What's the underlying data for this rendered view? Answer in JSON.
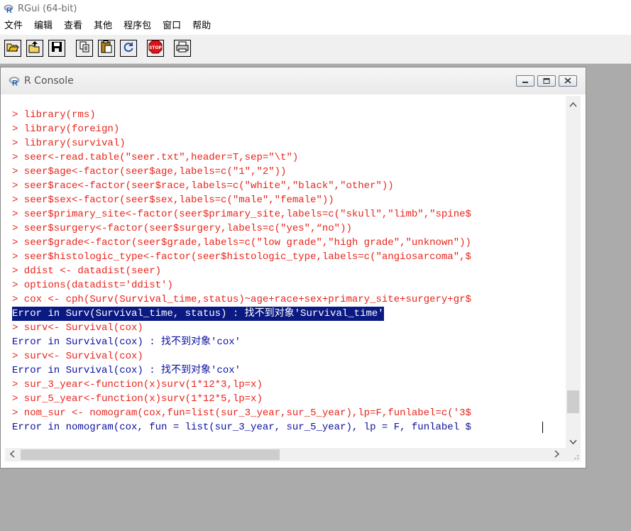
{
  "app": {
    "title": "RGui (64-bit)"
  },
  "menu": [
    "文件",
    "编辑",
    "查看",
    "其他",
    "程序包",
    "窗口",
    "帮助"
  ],
  "toolbar": {
    "buttons": [
      "open-script-icon",
      "load-workspace-icon",
      "save-workspace-icon",
      "copy-icon",
      "paste-icon",
      "copy-paste-icon",
      "stop-icon",
      "print-icon"
    ],
    "stop_label": "STOP"
  },
  "console": {
    "title": "R Console",
    "lines": [
      {
        "type": "cmd",
        "text": "> library(rms)"
      },
      {
        "type": "cmd",
        "text": "> library(foreign)"
      },
      {
        "type": "cmd",
        "text": "> library(survival)"
      },
      {
        "type": "cmd",
        "text": "> seer<-read.table(\"seer.txt\",header=T,sep=\"\\t\")"
      },
      {
        "type": "cmd",
        "text": "> seer$age<-factor(seer$age,labels=c(\"1\",\"2\"))"
      },
      {
        "type": "cmd",
        "text": "> seer$race<-factor(seer$race,labels=c(\"white\",\"black\",\"other\"))"
      },
      {
        "type": "cmd",
        "text": "> seer$sex<-factor(seer$sex,labels=c(\"male\",\"female\"))"
      },
      {
        "type": "cmd",
        "text": "> seer$primary_site<-factor(seer$primary_site,labels=c(\"skull\",\"limb\",\"spine$"
      },
      {
        "type": "cmd",
        "text": "> seer$surgery<-factor(seer$surgery,labels=c(\"yes\",“no\"))"
      },
      {
        "type": "cmd",
        "text": "> seer$grade<-factor(seer$grade,labels=c(\"low grade\",\"high grade\",\"unknown\"))"
      },
      {
        "type": "cmd",
        "text": "> seer$histologic_type<-factor(seer$histologic_type,labels=c(\"angiosarcoma\",$"
      },
      {
        "type": "cmd",
        "text": "> ddist <- datadist(seer)"
      },
      {
        "type": "cmd",
        "text": "> options(datadist='ddist')"
      },
      {
        "type": "cmd",
        "text": "> cox <- cph(Surv(Survival_time,status)~age+race+sex+primary_site+surgery+gr$"
      },
      {
        "type": "sel",
        "text": "Error in Surv(Survival_time, status) : 找不到对象'Survival_time'"
      },
      {
        "type": "cmd",
        "text": "> surv<- Survival(cox)"
      },
      {
        "type": "err",
        "text": "Error in Survival(cox) : 找不到对象'cox'"
      },
      {
        "type": "cmd",
        "text": "> surv<- Survival(cox)"
      },
      {
        "type": "err",
        "text": "Error in Survival(cox) : 找不到对象'cox'"
      },
      {
        "type": "cmd",
        "text": "> sur_3_year<-function(x)surv(1*12*3,lp=x)"
      },
      {
        "type": "cmd",
        "text": "> sur_5_year<-function(x)surv(1*12*5,lp=x)"
      },
      {
        "type": "cmd",
        "text": "> nom_sur <- nomogram(cox,fun=list(sur_3_year,sur_5_year),lp=F,funlabel=c('3$"
      },
      {
        "type": "err",
        "text": "Error in nomogram(cox, fun = list(sur_3_year, sur_5_year), lp = F, funlabel $"
      }
    ]
  },
  "colors": {
    "command": "#e8241b",
    "error": "#0b0f9e",
    "selection_bg": "#0a1a82",
    "mdi_background": "#ababab"
  }
}
